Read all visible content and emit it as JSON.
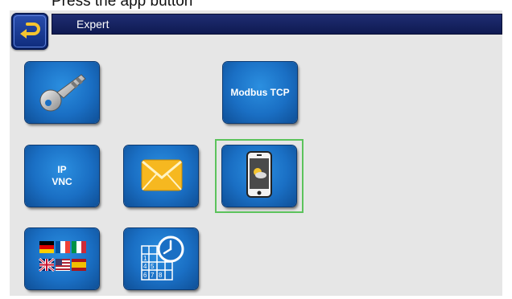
{
  "caption": "Press the app button",
  "header": {
    "title": "Expert"
  },
  "tiles": {
    "modbus_label": "Modbus TCP",
    "ip_vnc_line1": "IP",
    "ip_vnc_line2": "VNC"
  },
  "icons": {
    "back": "back-arrow-icon",
    "key": "key-icon",
    "email": "envelope-icon",
    "app": "smartphone-app-icon",
    "language": "language-flags-icon",
    "datetime": "calendar-clock-icon"
  },
  "colors": {
    "title_bar": "#1f2d72",
    "tile_blue": "#1a6fc4",
    "highlight": "#5cc35c",
    "envelope": "#f6b820"
  }
}
